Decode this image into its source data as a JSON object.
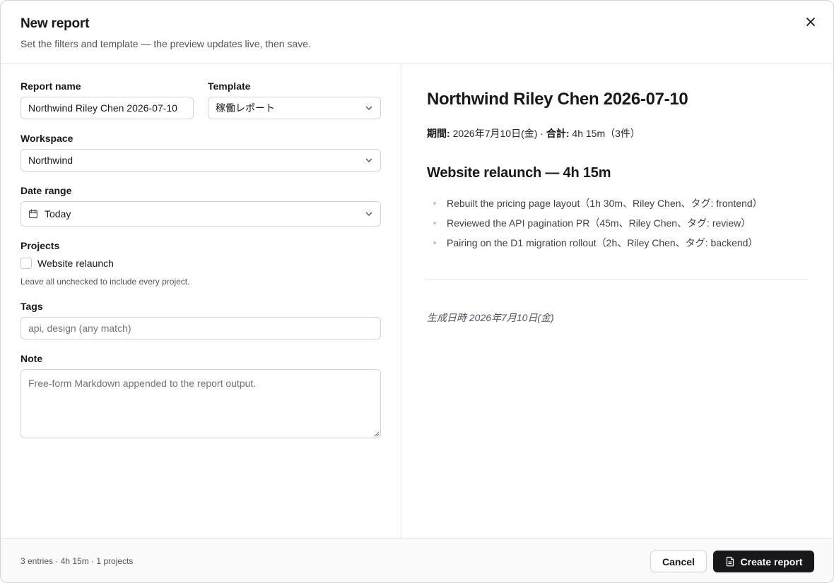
{
  "header": {
    "title": "New report",
    "subtitle": "Set the filters and template — the preview updates live, then save."
  },
  "form": {
    "report_name": {
      "label": "Report name",
      "value": "Northwind Riley Chen 2026-07-10"
    },
    "template": {
      "label": "Template",
      "value": "稼働レポート"
    },
    "workspace": {
      "label": "Workspace",
      "value": "Northwind"
    },
    "date_range": {
      "label": "Date range",
      "value": "Today"
    },
    "projects": {
      "label": "Projects",
      "items": [
        {
          "label": "Website relaunch",
          "checked": false
        }
      ],
      "hint": "Leave all unchecked to include every project."
    },
    "tags": {
      "label": "Tags",
      "placeholder": "api, design (any match)"
    },
    "note": {
      "label": "Note",
      "placeholder": "Free-form Markdown appended to the report output."
    }
  },
  "preview": {
    "title": "Northwind Riley Chen 2026-07-10",
    "period_label": "期間:",
    "period_value": "2026年7月10日(金)",
    "sep": "·",
    "total_label": "合計:",
    "total_value": "4h 15m（3件）",
    "section_heading": "Website relaunch — 4h 15m",
    "entries": [
      "Rebuilt the pricing page layout（1h 30m、Riley Chen、タグ: frontend）",
      "Reviewed the API pagination PR（45m、Riley Chen、タグ: review）",
      "Pairing on the D1 migration rollout（2h、Riley Chen、タグ: backend）"
    ],
    "generated": "生成日時 2026年7月10日(金)"
  },
  "footer": {
    "summary": "3 entries · 4h 15m · 1 projects",
    "cancel_label": "Cancel",
    "create_label": "Create report"
  },
  "icons": {
    "close": "close-icon",
    "chevron": "chevron-down-icon",
    "calendar": "calendar-icon",
    "document": "document-icon",
    "resize": "resize-grip-icon"
  },
  "colors": {
    "primary_button": "#18181b",
    "border": "#d4d4d8",
    "muted_text": "#71717a"
  }
}
